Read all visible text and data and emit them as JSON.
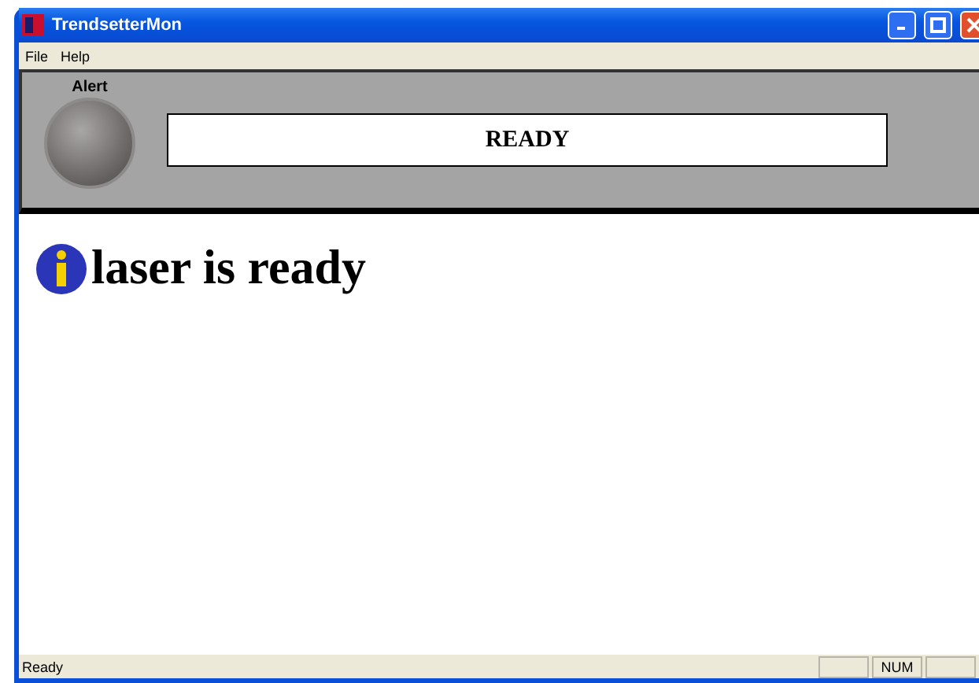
{
  "window": {
    "title": "TrendsetterMon"
  },
  "menu": [
    "File",
    "Help"
  ],
  "alert": {
    "label": "Alert"
  },
  "status_display": "READY",
  "message": "laser is ready",
  "status_bar": {
    "text": "Ready",
    "indicators": [
      "NUM"
    ]
  }
}
